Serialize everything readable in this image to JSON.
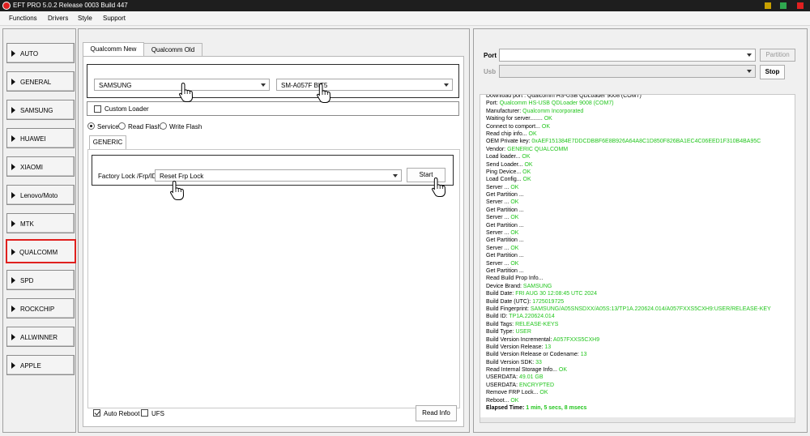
{
  "window": {
    "title": "EFT PRO 5.0.2 Release 0003 Build 447",
    "btn_colors": [
      "#c8a000",
      "#2fa84f",
      "#e02020"
    ]
  },
  "menu": [
    "Functions",
    "Drivers",
    "Style",
    "Support"
  ],
  "sidebar": {
    "items": [
      {
        "label": "AUTO"
      },
      {
        "label": "GENERAL"
      },
      {
        "label": "SAMSUNG"
      },
      {
        "label": "HUAWEI"
      },
      {
        "label": "XIAOMI"
      },
      {
        "label": "Lenovo/Moto"
      },
      {
        "label": "MTK"
      },
      {
        "label": "QUALCOMM",
        "selected": true
      },
      {
        "label": "SPD"
      },
      {
        "label": "ROCKCHIP"
      },
      {
        "label": "ALLWINNER"
      },
      {
        "label": "APPLE"
      }
    ]
  },
  "center": {
    "tabs": [
      "Qualcomm New",
      "Qualcomm Old"
    ],
    "brand_select": "SAMSUNG",
    "model_select": "SM-A057F BIT5",
    "custom_loader": "Custom Loader",
    "modes": [
      {
        "label": "Service",
        "selected": true
      },
      {
        "label": "Read Flash",
        "selected": false
      },
      {
        "label": "Write Flash",
        "selected": false
      }
    ],
    "sub_tab": "GENERIC",
    "frp_label": "Factory Lock /Frp/ID",
    "frp_select": "Reset Frp Lock",
    "start_button": "Start",
    "auto_reboot": "Auto Reboot",
    "ufs": "UFS",
    "read_info_button": "Read Info"
  },
  "right": {
    "port_label": "Port",
    "port_value": "",
    "usb_label": "Usb",
    "usb_value": "",
    "partition_button": "Partition",
    "stop_button": "Stop",
    "log": [
      {
        "t": "Download port : Qualcomm HS-USB QDLoader 9008 (COM7)",
        "v": ""
      },
      {
        "t": "Port: ",
        "v": "Qualcomm HS-USB QDLoader 9008 (COM7)"
      },
      {
        "t": "Manufacturer: ",
        "v": "Qualcomm Incorporated"
      },
      {
        "t": "Waiting for server........ ",
        "v": "OK"
      },
      {
        "t": "Connect to comport... ",
        "v": "OK"
      },
      {
        "t": "Read chip info... ",
        "v": "OK"
      },
      {
        "t": "OEM Private key: ",
        "v": "0xAEF151384E7DDCDBBF6E8B926A64A8C1D850F826BA1EC4C06EED1F310B4BA95C"
      },
      {
        "t": "Vendor: ",
        "v": "GENERIC QUALCOMM"
      },
      {
        "t": "Load loader... ",
        "v": "OK"
      },
      {
        "t": "Send Loader... ",
        "v": "OK"
      },
      {
        "t": "Ping Device... ",
        "v": "OK"
      },
      {
        "t": "Load Config... ",
        "v": "OK"
      },
      {
        "t": "Server ... ",
        "v": "OK"
      },
      {
        "t": "Get Partition ...",
        "v": ""
      },
      {
        "t": "Server ... ",
        "v": "OK"
      },
      {
        "t": "Get Partition ...",
        "v": ""
      },
      {
        "t": "Server ... ",
        "v": "OK"
      },
      {
        "t": "Get Partition ...",
        "v": ""
      },
      {
        "t": "Server ... ",
        "v": "OK"
      },
      {
        "t": "Get Partition ...",
        "v": ""
      },
      {
        "t": "Server ... ",
        "v": "OK"
      },
      {
        "t": "Get Partition ...",
        "v": ""
      },
      {
        "t": "Server ... ",
        "v": "OK"
      },
      {
        "t": "Get Partition ...",
        "v": ""
      },
      {
        "t": "Read Build Prop Info...",
        "v": ""
      },
      {
        "t": " Device Brand: ",
        "v": "SAMSUNG"
      },
      {
        "t": " Build Date: ",
        "v": "FRI AUG 30 12:08:45 UTC 2024"
      },
      {
        "t": " Build Date (UTC): ",
        "v": "1725019725"
      },
      {
        "t": " Build Fingerprint: ",
        "v": "SAMSUNG/A05SNSDXX/A05S:13/TP1A.220624.014/A057FXXS5CXH9:USER/RELEASE-KEY"
      },
      {
        "t": " Build ID: ",
        "v": "TP1A.220624.014"
      },
      {
        "t": " Build Tags: ",
        "v": "RELEASE-KEYS"
      },
      {
        "t": " Build Type: ",
        "v": "USER"
      },
      {
        "t": " Build Version Incremental: ",
        "v": "A057FXXS5CXH9"
      },
      {
        "t": " Build Version Release: ",
        "v": "13"
      },
      {
        "t": " Build Version Release or Codename: ",
        "v": "13"
      },
      {
        "t": " Build Version SDK: ",
        "v": "33"
      },
      {
        "t": "Read Internal Storage Info... ",
        "v": "OK"
      },
      {
        "t": "USERDATA: ",
        "v": "49.01 GB"
      },
      {
        "t": "USERDATA: ",
        "v": "ENCRYPTED"
      },
      {
        "t": "Remove FRP Lock... ",
        "v": "OK"
      },
      {
        "t": "Reboot... ",
        "v": "OK"
      },
      {
        "t": "Elapsed Time: ",
        "v": "1 min, 5 secs, 8 msecs",
        "bold": true
      }
    ]
  }
}
